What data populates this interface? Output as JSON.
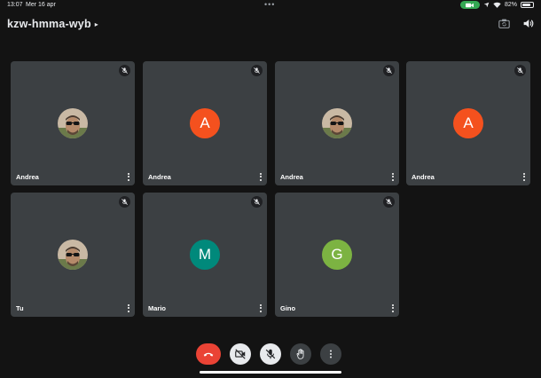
{
  "status_bar": {
    "time": "13:07",
    "date": "Mer 16 apr",
    "multitask_dots": "•••",
    "battery_pct": "82%",
    "battery_level": 0.82,
    "camera_indicator_color": "#34a853"
  },
  "meeting": {
    "code": "kzw-hmma-wyb",
    "code_chevron": "▸"
  },
  "participants": [
    {
      "name": "Andrea",
      "avatar_type": "photo",
      "muted": true
    },
    {
      "name": "Andrea",
      "avatar_type": "letter",
      "initial": "A",
      "color": "#f4511e",
      "muted": true
    },
    {
      "name": "Andrea",
      "avatar_type": "photo",
      "muted": true
    },
    {
      "name": "Andrea",
      "avatar_type": "letter",
      "initial": "A",
      "color": "#f4511e",
      "muted": true
    },
    {
      "name": "Tu",
      "avatar_type": "photo",
      "muted": true
    },
    {
      "name": "Mario",
      "avatar_type": "letter",
      "initial": "M",
      "color": "#00897b",
      "muted": true
    },
    {
      "name": "Gino",
      "avatar_type": "letter",
      "initial": "G",
      "color": "#7cb342",
      "muted": true
    }
  ],
  "colors": {
    "background": "#131313",
    "tile": "#3c4043",
    "end_call": "#ea4335",
    "control_light": "#e8eaed",
    "control_dark": "#3c4043"
  },
  "icons": {
    "header": [
      "switch-camera-icon",
      "speaker-icon"
    ],
    "tile": [
      "mic-off-icon",
      "more-vert-icon"
    ],
    "controls": [
      "call-end-icon",
      "videocam-off-icon",
      "mic-off-icon",
      "raise-hand-icon",
      "more-vert-icon"
    ]
  }
}
